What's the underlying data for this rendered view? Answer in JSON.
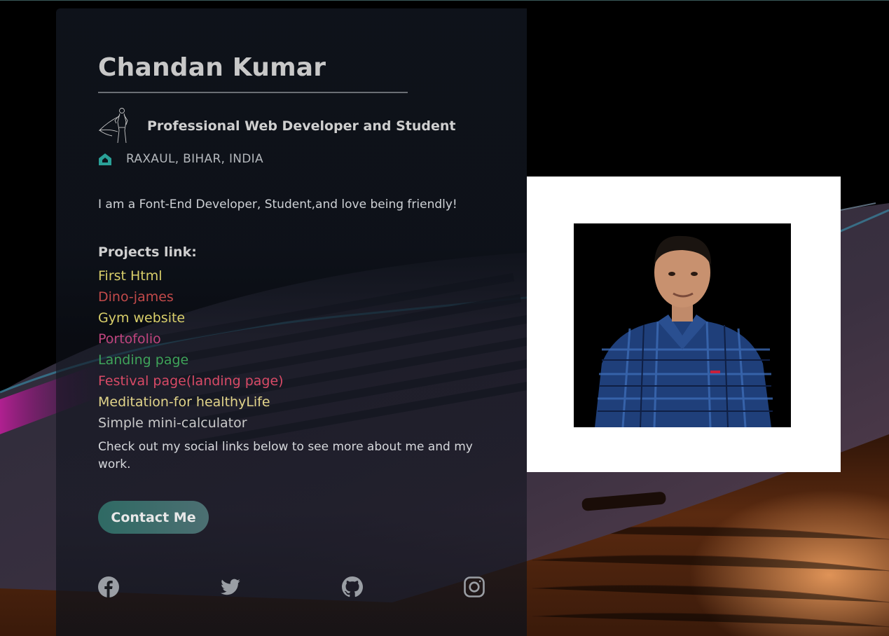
{
  "profile": {
    "name": "Chandan Kumar",
    "role": "Professional Web Developer and Student",
    "location": "RAXAUL, BIHAR, INDIA",
    "intro": "I am a Font-End Developer, Student,and love being friendly!"
  },
  "projects": {
    "heading": "Projects link:",
    "items": [
      {
        "label": "First Html",
        "color": "#d9cf6a"
      },
      {
        "label": "Dino-james",
        "color": "#c24a4a"
      },
      {
        "label": "Gym website",
        "color": "#d9cf6a"
      },
      {
        "label": "Portofolio",
        "color": "#c0447e"
      },
      {
        "label": "Landing page",
        "color": "#3fa35a"
      },
      {
        "label": "Festival page(landing page)",
        "color": "#d84a66"
      },
      {
        "label": "Meditation-for healthyLife",
        "color": "#e2d48a"
      },
      {
        "label": "Simple mini-calculator",
        "color": "#c9c9c9"
      }
    ]
  },
  "social": {
    "text": "Check out my social links below to see more about me and my work.",
    "contact_label": "Contact Me",
    "icons": [
      "facebook-icon",
      "twitter-icon",
      "github-icon",
      "instagram-icon"
    ]
  },
  "colors": {
    "accent": "#2aa198",
    "card_bg": "#0e121a",
    "name_color": "#c8c8c8"
  }
}
